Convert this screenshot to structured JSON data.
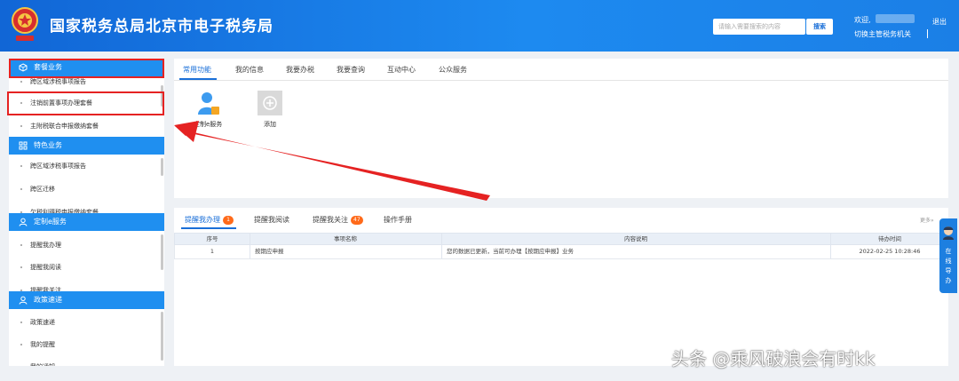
{
  "header": {
    "title": "国家税务总局北京市电子税务局",
    "search_placeholder": "请输入需要搜索的内容",
    "search_button": "搜索",
    "welcome": "欢迎,",
    "switch_org": "切换主管税务机关",
    "logout": "退出"
  },
  "sidebar": {
    "sections": [
      {
        "title": "套餐业务",
        "items": [
          "跨区域涉税事项报告",
          "注销前置事项办理套餐",
          "主附税联合申报缴纳套餐"
        ]
      },
      {
        "title": "特色业务",
        "items": [
          "跨区域涉税事项报告",
          "跨区迁移",
          "欠税利得税申报缴纳套餐"
        ]
      },
      {
        "title": "定制e服务",
        "items": [
          "提醒我办理",
          "提醒我阅读",
          "提醒我关注"
        ]
      },
      {
        "title": "政策速递",
        "items": [
          "政策速递",
          "我的提醒",
          "我的通知"
        ]
      }
    ]
  },
  "top_tabs": [
    "常用功能",
    "我的信息",
    "我要办税",
    "我要查询",
    "互动中心",
    "公众服务"
  ],
  "functions": [
    {
      "label": "定制e服务",
      "icon": "user-icon"
    },
    {
      "label": "添加",
      "icon": "add-icon"
    }
  ],
  "bottom_tabs": [
    {
      "label": "提醒我办理",
      "badge": "1"
    },
    {
      "label": "提醒我阅读",
      "badge": ""
    },
    {
      "label": "提醒我关注",
      "badge": "47"
    },
    {
      "label": "操作手册",
      "badge": ""
    }
  ],
  "more_label": "更多»",
  "table": {
    "headers": [
      "序号",
      "事项名称",
      "内容说明",
      "待办时间"
    ],
    "rows": [
      [
        "1",
        "按期应申报",
        "您的数据已更新，当前可办理【按期应申报】业务",
        "2022-02-25 10:28:46"
      ]
    ]
  },
  "float_nav": {
    "label": "在线导办"
  },
  "watermark": "头条 @乘风破浪会有时kk",
  "colors": {
    "primary": "#1a6fd8",
    "header_blue": "#1d8af0",
    "highlight_red": "#e52222",
    "badge_orange": "#ff6a1a"
  }
}
